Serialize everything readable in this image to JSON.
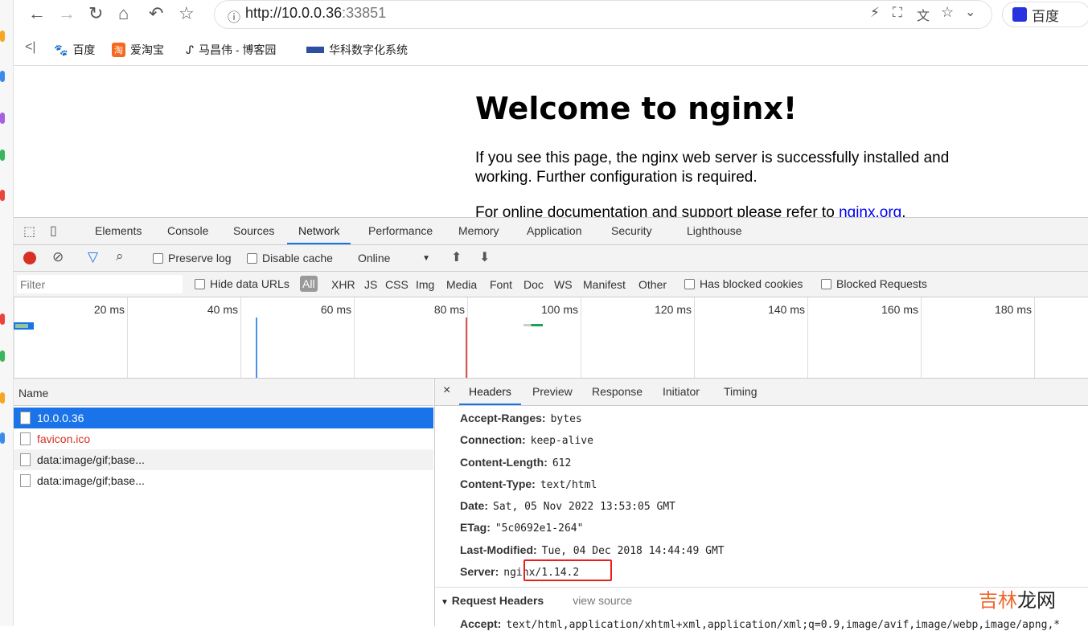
{
  "browser": {
    "url_host": "http://10.0.0.36",
    "url_port": ":33851",
    "profile_label": "百度"
  },
  "bookmarks": [
    {
      "label": "百度"
    },
    {
      "label": "爱淘宝"
    },
    {
      "label": "马昌伟 - 博客园"
    },
    {
      "label": "华科数字化系统"
    }
  ],
  "page": {
    "title": "Welcome to nginx!",
    "para1": "If you see this page, the nginx web server is successfully installed and working. Further configuration is required.",
    "para2_prefix": "For online documentation and support please refer to ",
    "para2_link": "nginx.org",
    "para2_suffix": "."
  },
  "devtools": {
    "tabs": [
      "Elements",
      "Console",
      "Sources",
      "Network",
      "Performance",
      "Memory",
      "Application",
      "Security",
      "Lighthouse"
    ],
    "active_tab": "Network",
    "toolbar": {
      "preserve_log": "Preserve log",
      "disable_cache": "Disable cache",
      "throttle": "Online"
    },
    "filter": {
      "placeholder": "Filter",
      "hide_data_urls": "Hide data URLs",
      "types": [
        "All",
        "XHR",
        "JS",
        "CSS",
        "Img",
        "Media",
        "Font",
        "Doc",
        "WS",
        "Manifest",
        "Other"
      ],
      "blocked_cookies": "Has blocked cookies",
      "blocked_requests": "Blocked Requests"
    },
    "timeline_ticks": [
      "20 ms",
      "40 ms",
      "60 ms",
      "80 ms",
      "100 ms",
      "120 ms",
      "140 ms",
      "160 ms",
      "180 ms"
    ],
    "name_header": "Name",
    "requests": [
      {
        "name": "10.0.0.36",
        "selected": true
      },
      {
        "name": "favicon.ico",
        "error": true
      },
      {
        "name": "data:image/gif;base..."
      },
      {
        "name": "data:image/gif;base..."
      }
    ],
    "detail_tabs": [
      "Headers",
      "Preview",
      "Response",
      "Initiator",
      "Timing"
    ],
    "response_headers": [
      {
        "k": "Accept-Ranges:",
        "v": "bytes"
      },
      {
        "k": "Connection:",
        "v": "keep-alive"
      },
      {
        "k": "Content-Length:",
        "v": "612"
      },
      {
        "k": "Content-Type:",
        "v": "text/html"
      },
      {
        "k": "Date:",
        "v": "Sat, 05 Nov 2022 13:53:05 GMT"
      },
      {
        "k": "ETag:",
        "v": "\"5c0692e1-264\""
      },
      {
        "k": "Last-Modified:",
        "v": "Tue, 04 Dec 2018 14:44:49 GMT"
      },
      {
        "k": "Server:",
        "v": "nginx/1.14.2"
      }
    ],
    "request_headers_title": "Request Headers",
    "view_source": "view source",
    "accept_row": {
      "k": "Accept:",
      "v": "text/html,application/xhtml+xml,application/xml;q=0.9,image/avif,image/webp,image/apng,*"
    }
  },
  "watermark": {
    "a": "吉林",
    "b": "龙网"
  }
}
